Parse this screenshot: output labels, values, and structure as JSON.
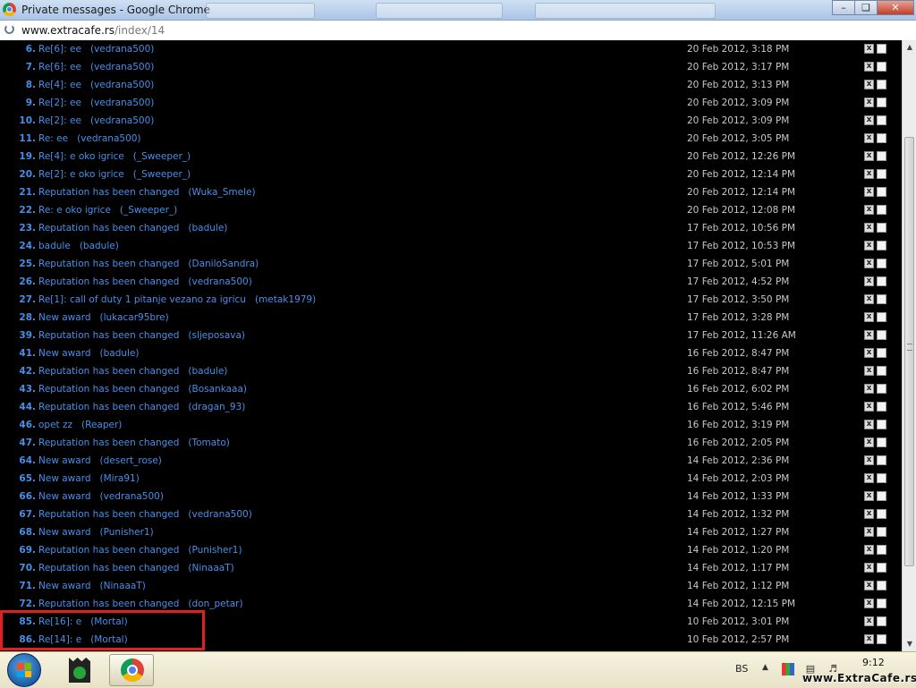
{
  "window": {
    "title": "Private messages - Google Chrome"
  },
  "address": {
    "host": "www.extracafe.rs",
    "path": "/index/14"
  },
  "messages": [
    {
      "num": "6.",
      "subject": "Re[6]: ee",
      "author": "(vedrana500)",
      "date": "20 Feb 2012, 3:18 PM"
    },
    {
      "num": "7.",
      "subject": "Re[6]: ee",
      "author": "(vedrana500)",
      "date": "20 Feb 2012, 3:17 PM"
    },
    {
      "num": "8.",
      "subject": "Re[4]: ee",
      "author": "(vedrana500)",
      "date": "20 Feb 2012, 3:13 PM"
    },
    {
      "num": "9.",
      "subject": "Re[2]: ee",
      "author": "(vedrana500)",
      "date": "20 Feb 2012, 3:09 PM"
    },
    {
      "num": "10.",
      "subject": "Re[2]: ee",
      "author": "(vedrana500)",
      "date": "20 Feb 2012, 3:09 PM"
    },
    {
      "num": "11.",
      "subject": "Re: ee",
      "author": "(vedrana500)",
      "date": "20 Feb 2012, 3:05 PM"
    },
    {
      "num": "19.",
      "subject": "Re[4]: e oko igrice",
      "author": "(_Sweeper_)",
      "date": "20 Feb 2012, 12:26 PM"
    },
    {
      "num": "20.",
      "subject": "Re[2]: e oko igrice",
      "author": "(_Sweeper_)",
      "date": "20 Feb 2012, 12:14 PM"
    },
    {
      "num": "21.",
      "subject": "Reputation has been changed",
      "author": "(Wuka_Smele)",
      "date": "20 Feb 2012, 12:14 PM"
    },
    {
      "num": "22.",
      "subject": "Re: e oko igrice",
      "author": "(_Sweeper_)",
      "date": "20 Feb 2012, 12:08 PM"
    },
    {
      "num": "23.",
      "subject": "Reputation has been changed",
      "author": "(badule)",
      "date": "17 Feb 2012, 10:56 PM"
    },
    {
      "num": "24.",
      "subject": "badule",
      "author": "(badule)",
      "date": "17 Feb 2012, 10:53 PM"
    },
    {
      "num": "25.",
      "subject": "Reputation has been changed",
      "author": "(DaniloSandra)",
      "date": "17 Feb 2012, 5:01 PM"
    },
    {
      "num": "26.",
      "subject": "Reputation has been changed",
      "author": "(vedrana500)",
      "date": "17 Feb 2012, 4:52 PM"
    },
    {
      "num": "27.",
      "subject": "Re[1]: call of duty 1 pitanje vezano za igricu",
      "author": "(metak1979)",
      "date": "17 Feb 2012, 3:50 PM"
    },
    {
      "num": "28.",
      "subject": "New award",
      "author": "(lukacar95bre)",
      "date": "17 Feb 2012, 3:28 PM"
    },
    {
      "num": "39.",
      "subject": "Reputation has been changed",
      "author": "(sljeposava)",
      "date": "17 Feb 2012, 11:26 AM"
    },
    {
      "num": "41.",
      "subject": "New award",
      "author": "(badule)",
      "date": "16 Feb 2012, 8:47 PM"
    },
    {
      "num": "42.",
      "subject": "Reputation has been changed",
      "author": "(badule)",
      "date": "16 Feb 2012, 8:47 PM"
    },
    {
      "num": "43.",
      "subject": "Reputation has been changed",
      "author": "(Bosankaaa)",
      "date": "16 Feb 2012, 6:02 PM"
    },
    {
      "num": "44.",
      "subject": "Reputation has been changed",
      "author": "(dragan_93)",
      "date": "16 Feb 2012, 5:46 PM"
    },
    {
      "num": "46.",
      "subject": "opet zz",
      "author": "(Reaper)",
      "date": "16 Feb 2012, 3:19 PM"
    },
    {
      "num": "47.",
      "subject": "Reputation has been changed",
      "author": "(Tomato)",
      "date": "16 Feb 2012, 2:05 PM"
    },
    {
      "num": "64.",
      "subject": "New award",
      "author": "(desert_rose)",
      "date": "14 Feb 2012, 2:36 PM"
    },
    {
      "num": "65.",
      "subject": "New award",
      "author": "(Mira91)",
      "date": "14 Feb 2012, 2:03 PM"
    },
    {
      "num": "66.",
      "subject": "New award",
      "author": "(vedrana500)",
      "date": "14 Feb 2012, 1:33 PM"
    },
    {
      "num": "67.",
      "subject": "Reputation has been changed",
      "author": "(vedrana500)",
      "date": "14 Feb 2012, 1:32 PM"
    },
    {
      "num": "68.",
      "subject": "New award",
      "author": "(Punisher1)",
      "date": "14 Feb 2012, 1:27 PM"
    },
    {
      "num": "69.",
      "subject": "Reputation has been changed",
      "author": "(Punisher1)",
      "date": "14 Feb 2012, 1:20 PM"
    },
    {
      "num": "70.",
      "subject": "Reputation has been changed",
      "author": "(NinaaaT)",
      "date": "14 Feb 2012, 1:17 PM"
    },
    {
      "num": "71.",
      "subject": "New award",
      "author": "(NinaaaT)",
      "date": "14 Feb 2012, 1:12 PM"
    },
    {
      "num": "72.",
      "subject": "Reputation has been changed",
      "author": "(don_petar)",
      "date": "14 Feb 2012, 12:15 PM"
    },
    {
      "num": "85.",
      "subject": "Re[16]: e",
      "author": "(Mortal)",
      "date": "10 Feb 2012, 3:01 PM"
    },
    {
      "num": "86.",
      "subject": "Re[14]: e",
      "author": "(Mortal)",
      "date": "10 Feb 2012, 2:57 PM"
    }
  ],
  "row_controls": {
    "delete_icon": "x"
  },
  "taskbar": {
    "language": "BS",
    "time": "9:12",
    "watermark": "www.ExtraCafe.rs"
  },
  "colors": {
    "link": "#4a8fe6",
    "date": "#c9c9c9",
    "highlight": "#e02020",
    "background": "#000000"
  }
}
